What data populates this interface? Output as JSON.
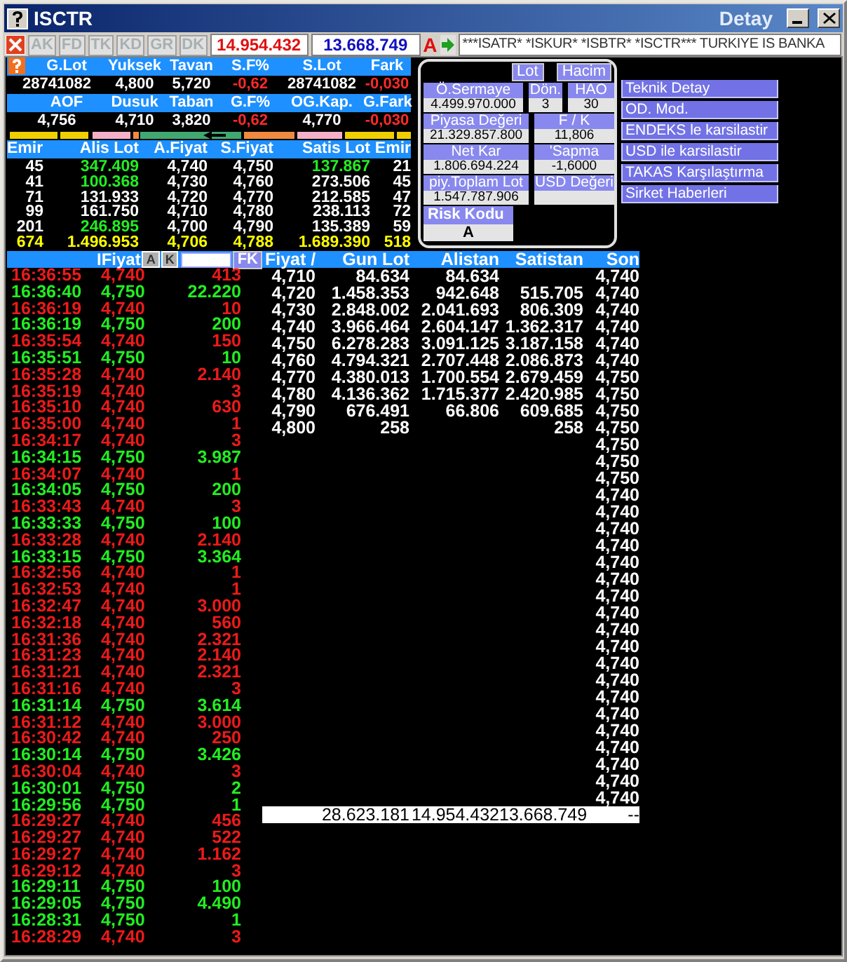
{
  "window": {
    "title": "ISCTR",
    "faded_title": "Detay"
  },
  "toolbar": {
    "buttons": [
      {
        "label": "AK",
        "disabled": true
      },
      {
        "label": "FD",
        "disabled": true
      },
      {
        "label": "TK",
        "disabled": true
      },
      {
        "label": "KD",
        "disabled": true
      },
      {
        "label": "GR",
        "disabled": true
      },
      {
        "label": "DK",
        "disabled": true
      }
    ],
    "value_1": "14.954.432",
    "value_2": "13.668.749",
    "mode": "A",
    "ticker": "***ISATR* *ISKUR* *ISBTR* *ISCTR*** TURKIYE IS BANKA"
  },
  "summary": [
    {
      "headers": [
        "G.Lot",
        "Yuksek",
        "Tavan",
        "S.F%",
        "S.Lot",
        "Fark"
      ],
      "values": [
        {
          "text": "28741082",
          "negative": false
        },
        {
          "text": "4,800",
          "negative": false
        },
        {
          "text": "5,720",
          "negative": false
        },
        {
          "text": "-0,62",
          "negative": true
        },
        {
          "text": "28741082",
          "negative": false
        },
        {
          "text": "-0,030",
          "negative": true
        }
      ]
    },
    {
      "headers": [
        "AOF",
        "Dusuk",
        "Taban",
        "G.F%",
        "OG.Kap.",
        "G.Fark"
      ],
      "values": [
        {
          "text": "4,756",
          "negative": false
        },
        {
          "text": "4,710",
          "negative": false
        },
        {
          "text": "3,820",
          "negative": false
        },
        {
          "text": "-0,62",
          "negative": true
        },
        {
          "text": "4,770",
          "negative": false
        },
        {
          "text": "-0,030",
          "negative": true
        }
      ]
    }
  ],
  "order_book": {
    "columns": [
      "Emir",
      "Alis Lot",
      "A.Fiyat",
      "S.Fiyat",
      "Satis Lot",
      "Emir"
    ],
    "rows": [
      {
        "kind": "level",
        "cells": [
          "45",
          "347.409",
          "4,740",
          "4,750",
          "137.867",
          "21"
        ],
        "bid_lot_highlighted": true,
        "ask_lot_highlighted": true
      },
      {
        "kind": "level",
        "cells": [
          "41",
          "100.368",
          "4,730",
          "4,760",
          "273.506",
          "45"
        ],
        "bid_lot_highlighted": true,
        "ask_lot_highlighted": false
      },
      {
        "kind": "level",
        "cells": [
          "71",
          "131.933",
          "4,720",
          "4,770",
          "212.585",
          "47"
        ],
        "bid_lot_highlighted": false,
        "ask_lot_highlighted": false
      },
      {
        "kind": "level",
        "cells": [
          "99",
          "161.750",
          "4,710",
          "4,780",
          "238.113",
          "72"
        ],
        "bid_lot_highlighted": false,
        "ask_lot_highlighted": false
      },
      {
        "kind": "level",
        "cells": [
          "201",
          "246.895",
          "4,700",
          "4,790",
          "135.389",
          "59"
        ],
        "bid_lot_highlighted": true,
        "ask_lot_highlighted": false
      },
      {
        "kind": "total",
        "cells": [
          "674",
          "1.496.953",
          "4,706",
          "4,788",
          "1.689.390",
          "518"
        ]
      }
    ]
  },
  "info_panel": {
    "toggles": [
      "Lot",
      "Hacim"
    ],
    "rows": [
      [
        {
          "label": "Ö.Sermaye",
          "value": "4.499.970.000"
        },
        {
          "label": "Dön.",
          "value": "3"
        },
        {
          "label": "HAO",
          "value": "30"
        }
      ],
      [
        {
          "label": "Piyasa Değeri",
          "value": "21.329.857.800"
        },
        {
          "label": "F / K",
          "value": "11,806"
        }
      ],
      [
        {
          "label": "Net Kar",
          "value": "1.806.694.224"
        },
        {
          "label": "'Sapma",
          "value": "-1,6000"
        }
      ],
      [
        {
          "label": "piy.Toplam Lot",
          "value": "1.547.787.906"
        },
        {
          "label": "USD Değeri"
        }
      ]
    ],
    "risk": {
      "label": "Risk Kodu",
      "value": "A"
    }
  },
  "menu": [
    "Teknik Detay",
    "OD. Mod.",
    "ENDEKS le karsilastir",
    "USD ile karsilastir",
    "TAKAS Karşılaştırma",
    "Sirket Haberleri"
  ],
  "trades": {
    "header": "IFiyat",
    "buttons": [
      "A",
      "K"
    ],
    "filter_button": "FK",
    "rows": [
      {
        "time": "16:36:55",
        "price": "4,740",
        "lot": "413",
        "kind": "down"
      },
      {
        "time": "16:36:40",
        "price": "4,750",
        "lot": "22.220",
        "kind": "up"
      },
      {
        "time": "16:36:19",
        "price": "4,740",
        "lot": "10",
        "kind": "down"
      },
      {
        "time": "16:36:19",
        "price": "4,750",
        "lot": "200",
        "kind": "up"
      },
      {
        "time": "16:35:54",
        "price": "4,740",
        "lot": "150",
        "kind": "down"
      },
      {
        "time": "16:35:51",
        "price": "4,750",
        "lot": "10",
        "kind": "up"
      },
      {
        "time": "16:35:28",
        "price": "4,740",
        "lot": "2.140",
        "kind": "down"
      },
      {
        "time": "16:35:19",
        "price": "4,740",
        "lot": "3",
        "kind": "down"
      },
      {
        "time": "16:35:10",
        "price": "4,740",
        "lot": "630",
        "kind": "down"
      },
      {
        "time": "16:35:00",
        "price": "4,740",
        "lot": "1",
        "kind": "down"
      },
      {
        "time": "16:34:17",
        "price": "4,740",
        "lot": "3",
        "kind": "down"
      },
      {
        "time": "16:34:15",
        "price": "4,750",
        "lot": "3.987",
        "kind": "up"
      },
      {
        "time": "16:34:07",
        "price": "4,740",
        "lot": "1",
        "kind": "down"
      },
      {
        "time": "16:34:05",
        "price": "4,750",
        "lot": "200",
        "kind": "up"
      },
      {
        "time": "16:33:43",
        "price": "4,740",
        "lot": "3",
        "kind": "down"
      },
      {
        "time": "16:33:33",
        "price": "4,750",
        "lot": "100",
        "kind": "up"
      },
      {
        "time": "16:33:28",
        "price": "4,740",
        "lot": "2.140",
        "kind": "down"
      },
      {
        "time": "16:33:15",
        "price": "4,750",
        "lot": "3.364",
        "kind": "up"
      },
      {
        "time": "16:32:56",
        "price": "4,740",
        "lot": "1",
        "kind": "down"
      },
      {
        "time": "16:32:53",
        "price": "4,740",
        "lot": "1",
        "kind": "down"
      },
      {
        "time": "16:32:47",
        "price": "4,740",
        "lot": "3.000",
        "kind": "down"
      },
      {
        "time": "16:32:18",
        "price": "4,740",
        "lot": "560",
        "kind": "down"
      },
      {
        "time": "16:31:36",
        "price": "4,740",
        "lot": "2.321",
        "kind": "down"
      },
      {
        "time": "16:31:23",
        "price": "4,740",
        "lot": "2.140",
        "kind": "down"
      },
      {
        "time": "16:31:21",
        "price": "4,740",
        "lot": "2.321",
        "kind": "down"
      },
      {
        "time": "16:31:16",
        "price": "4,740",
        "lot": "3",
        "kind": "down"
      },
      {
        "time": "16:31:14",
        "price": "4,750",
        "lot": "3.614",
        "kind": "up"
      },
      {
        "time": "16:31:12",
        "price": "4,740",
        "lot": "3.000",
        "kind": "down"
      },
      {
        "time": "16:30:42",
        "price": "4,740",
        "lot": "250",
        "kind": "down"
      },
      {
        "time": "16:30:14",
        "price": "4,750",
        "lot": "3.426",
        "kind": "up"
      },
      {
        "time": "16:30:04",
        "price": "4,740",
        "lot": "3",
        "kind": "down"
      },
      {
        "time": "16:30:01",
        "price": "4,750",
        "lot": "2",
        "kind": "up"
      },
      {
        "time": "16:29:56",
        "price": "4,750",
        "lot": "1",
        "kind": "up"
      },
      {
        "time": "16:29:27",
        "price": "4,740",
        "lot": "456",
        "kind": "down"
      },
      {
        "time": "16:29:27",
        "price": "4,740",
        "lot": "522",
        "kind": "down"
      },
      {
        "time": "16:29:27",
        "price": "4,740",
        "lot": "1.162",
        "kind": "down"
      },
      {
        "time": "16:29:12",
        "price": "4,740",
        "lot": "3",
        "kind": "down"
      },
      {
        "time": "16:29:11",
        "price": "4,750",
        "lot": "100",
        "kind": "up"
      },
      {
        "time": "16:29:05",
        "price": "4,750",
        "lot": "4.490",
        "kind": "up"
      },
      {
        "time": "16:28:31",
        "price": "4,750",
        "lot": "1",
        "kind": "up"
      },
      {
        "time": "16:28:29",
        "price": "4,740",
        "lot": "3",
        "kind": "down"
      }
    ]
  },
  "price_table": {
    "columns": [
      "Fiyat /",
      "Gun Lot",
      "Alistan",
      "Satistan",
      "Son"
    ],
    "rows": [
      [
        "4,710",
        "84.634",
        "84.634",
        "",
        "4,740"
      ],
      [
        "4,720",
        "1.458.353",
        "942.648",
        "515.705",
        "4,740"
      ],
      [
        "4,730",
        "2.848.002",
        "2.041.693",
        "806.309",
        "4,740"
      ],
      [
        "4,740",
        "3.966.464",
        "2.604.147",
        "1.362.317",
        "4,740"
      ],
      [
        "4,750",
        "6.278.283",
        "3.091.125",
        "3.187.158",
        "4,740"
      ],
      [
        "4,760",
        "4.794.321",
        "2.707.448",
        "2.086.873",
        "4,740"
      ],
      [
        "4,770",
        "4.380.013",
        "1.700.554",
        "2.679.459",
        "4,750"
      ],
      [
        "4,780",
        "4.136.362",
        "1.715.377",
        "2.420.985",
        "4,750"
      ],
      [
        "4,790",
        "676.491",
        "66.806",
        "609.685",
        "4,750"
      ],
      [
        "4,800",
        "258",
        "",
        "258",
        "4,750"
      ]
    ],
    "son_continued": [
      "4,750",
      "4,750",
      "4,750",
      "4,740",
      "4,740",
      "4,740",
      "4,740",
      "4,740",
      "4,740",
      "4,740",
      "4,740",
      "4,740",
      "4,740",
      "4,740",
      "4,740",
      "4,740",
      "4,740",
      "4,740",
      "4,740",
      "4,740",
      "4,740",
      "4,740"
    ],
    "total": [
      "28.623.181",
      "14.954.432",
      "13.668.749",
      "--"
    ]
  }
}
